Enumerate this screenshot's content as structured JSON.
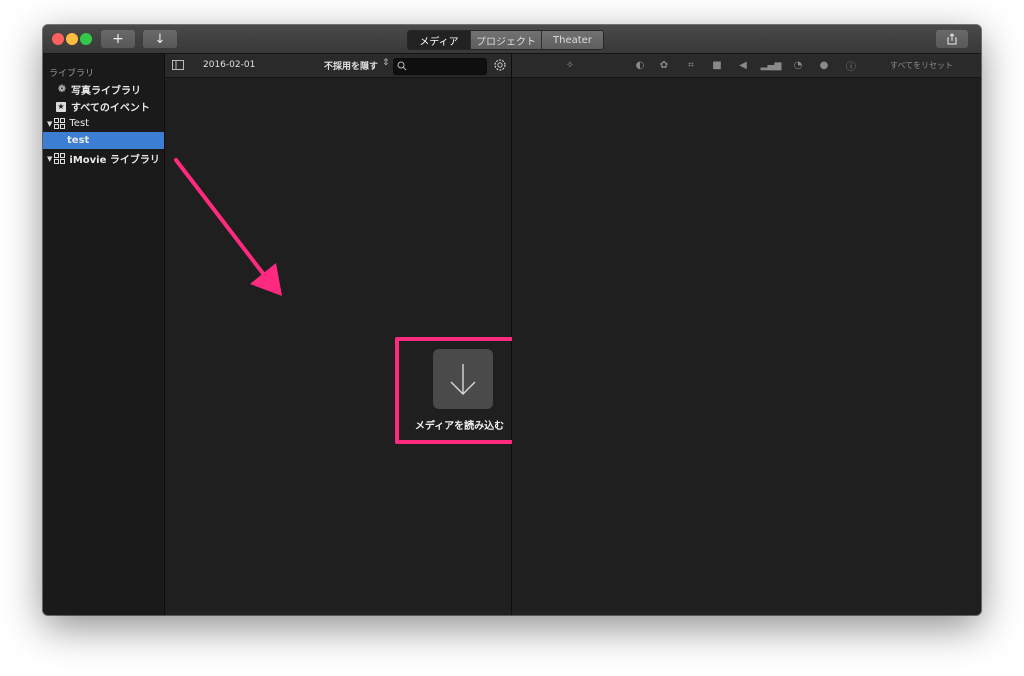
{
  "toolbar": {
    "add_label": "+",
    "import_arrow": "↓",
    "segments": [
      "メディア",
      "プロジェクト",
      "Theater"
    ],
    "active_segment": "メディア"
  },
  "sidebar": {
    "header": "ライブラリ",
    "items": [
      {
        "label": "写真ライブラリ",
        "icon": "flower-icon"
      },
      {
        "label": "すべてのイベント",
        "icon": "star-icon"
      },
      {
        "label": "Test",
        "icon": "grid-icon"
      },
      {
        "label": "test",
        "icon": "",
        "selected": true
      },
      {
        "label": "iMovie ライブラリ",
        "icon": "grid-icon"
      }
    ]
  },
  "browser": {
    "date": "2016-02-01",
    "filter": "不採用を隠す",
    "search": {
      "value": "",
      "placeholder": ""
    },
    "import_label": "メディアを読み込む"
  },
  "viewer": {
    "reset_label": "すべてをリセット",
    "tools": [
      "magic-wand-icon",
      "color-balance-icon",
      "palette-icon",
      "crop-icon",
      "camera-icon",
      "volume-icon",
      "equalizer-icon",
      "speed-icon",
      "filter-icon",
      "info-icon"
    ]
  },
  "colors": {
    "accent_highlight": "#ff2a7f",
    "selection": "#3b7ed4",
    "close": "#fc605c",
    "minimize": "#fdbc40",
    "zoom": "#34c84a"
  }
}
